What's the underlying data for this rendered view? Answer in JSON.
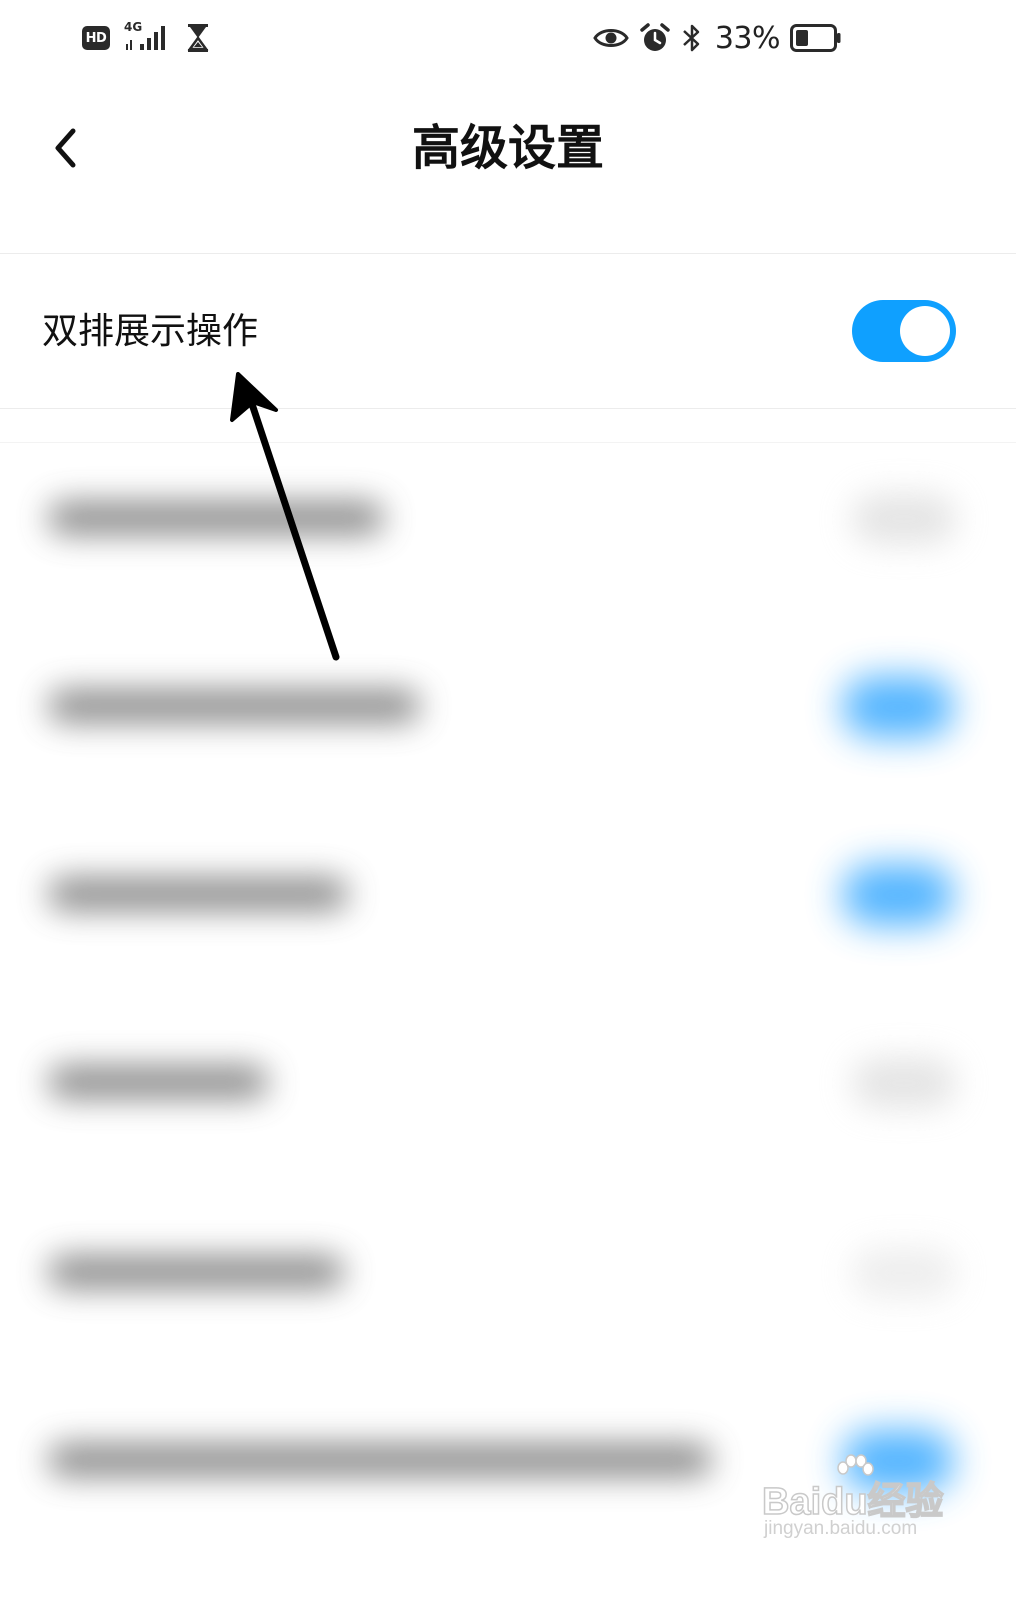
{
  "status_bar": {
    "hd_label": "HD",
    "network_label": "4G",
    "battery_percent": "33%",
    "battery_level": 0.33,
    "icons": [
      "hd-icon",
      "signal-icon",
      "hourglass-icon",
      "eye-icon",
      "alarm-icon",
      "bluetooth-icon",
      "battery-icon"
    ]
  },
  "header": {
    "title": "高级设置",
    "back_icon": "chevron-left-icon"
  },
  "settings": {
    "focused_item": {
      "label": "双排展示操作",
      "toggle_on": true
    },
    "blurred_items_toggle_states": [
      "off",
      "on",
      "on",
      "off",
      "off",
      "on"
    ]
  },
  "colors": {
    "accent": "#0fa0ff",
    "background": "#ffffff",
    "text": "#111111"
  },
  "watermark": {
    "brand": "Baidu经验",
    "url": "jingyan.baidu.com"
  }
}
